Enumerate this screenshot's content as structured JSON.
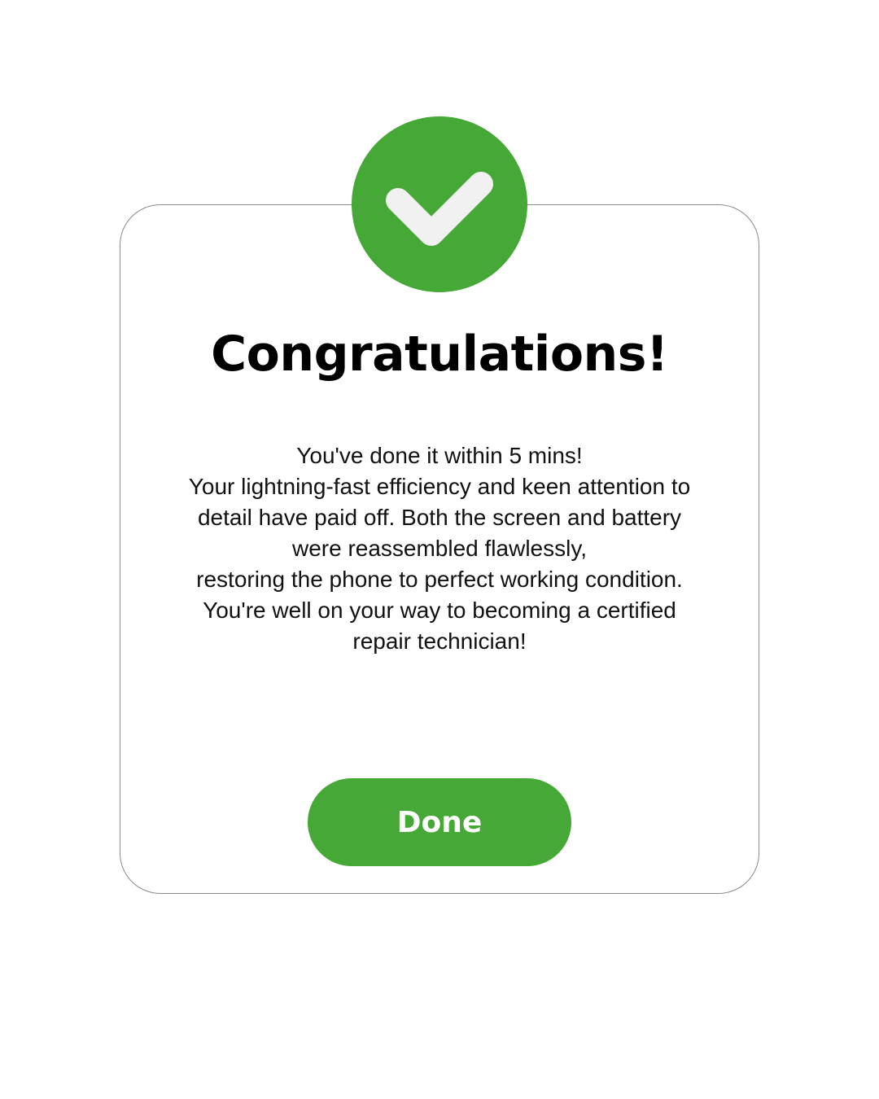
{
  "dialog": {
    "title": "Congratulations!",
    "message_lines": [
      "You've done it within 5 mins!",
      "Your lightning-fast efficiency and keen attention to",
      "detail have paid off. Both the screen and battery",
      "were reassembled flawlessly,",
      "restoring the phone to perfect working condition.",
      "You're well on your way to becoming a certified",
      "repair technician!"
    ],
    "done_label": "Done",
    "icon": "checkmark-icon"
  },
  "colors": {
    "accent": "#46a836",
    "checkmark": "#f1f1f1",
    "background": "#ffffff",
    "text": "#000000"
  }
}
